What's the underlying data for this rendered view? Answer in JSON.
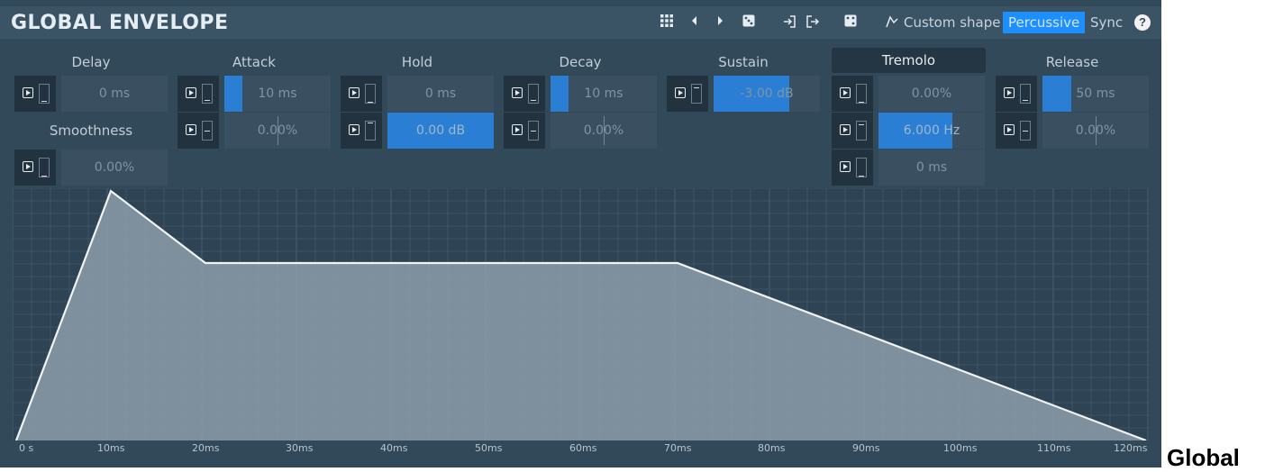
{
  "header": {
    "title": "GLOBAL ENVELOPE",
    "custom_shape_label": "Custom shape",
    "percussive_label": "Percussive",
    "sync_label": "Sync",
    "help_label": "?"
  },
  "columns": {
    "delay": "Delay",
    "attack": "Attack",
    "hold": "Hold",
    "decay": "Decay",
    "sustain": "Sustain",
    "tremolo": "Tremolo",
    "release": "Release",
    "smoothness": "Smoothness"
  },
  "params": {
    "delay_time": "0 ms",
    "attack_time": "10 ms",
    "attack_shape": "0.00%",
    "hold_time": "0 ms",
    "hold_level": "0.00 dB",
    "decay_time": "10 ms",
    "decay_shape": "0.00%",
    "sustain_level": "-3.00 dB",
    "tremolo_depth": "0.00%",
    "tremolo_rate": "6.000 Hz",
    "tremolo_delay": "0 ms",
    "release_time": "50 ms",
    "release_shape": "0.00%",
    "smoothness": "0.00%"
  },
  "envelope_axis": [
    "0 s",
    "10ms",
    "20ms",
    "30ms",
    "40ms",
    "50ms",
    "60ms",
    "70ms",
    "80ms",
    "90ms",
    "100ms",
    "110ms",
    "120ms"
  ],
  "colors": {
    "panel": "#32495a",
    "accent": "#1d8fff",
    "fill": "#2a7fd4"
  },
  "side_caption": "Global"
}
